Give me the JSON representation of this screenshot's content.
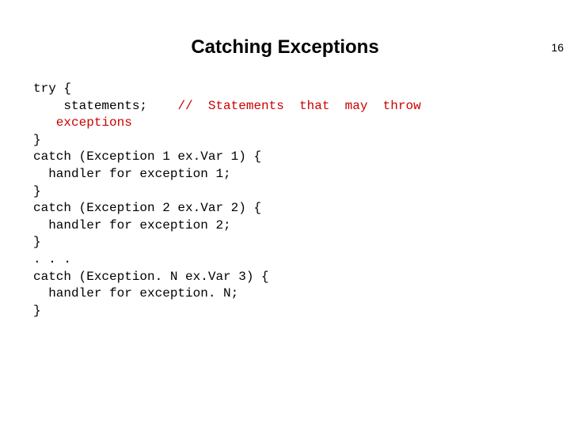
{
  "page_number": "16",
  "title": "Catching Exceptions",
  "code": {
    "l1": "try {",
    "l2a": "    statements;    ",
    "l2b": "//  Statements  that  may  throw",
    "l3": "   exceptions",
    "l4": "}",
    "l5": "catch (Exception 1 ex.Var 1) {",
    "l6": "  handler for exception 1;",
    "l7": "}",
    "l8": "catch (Exception 2 ex.Var 2) {",
    "l9": "  handler for exception 2;",
    "l10": "}",
    "l11": ". . .",
    "l12": "catch (Exception. N ex.Var 3) {",
    "l13": "  handler for exception. N;",
    "l14": "}"
  }
}
